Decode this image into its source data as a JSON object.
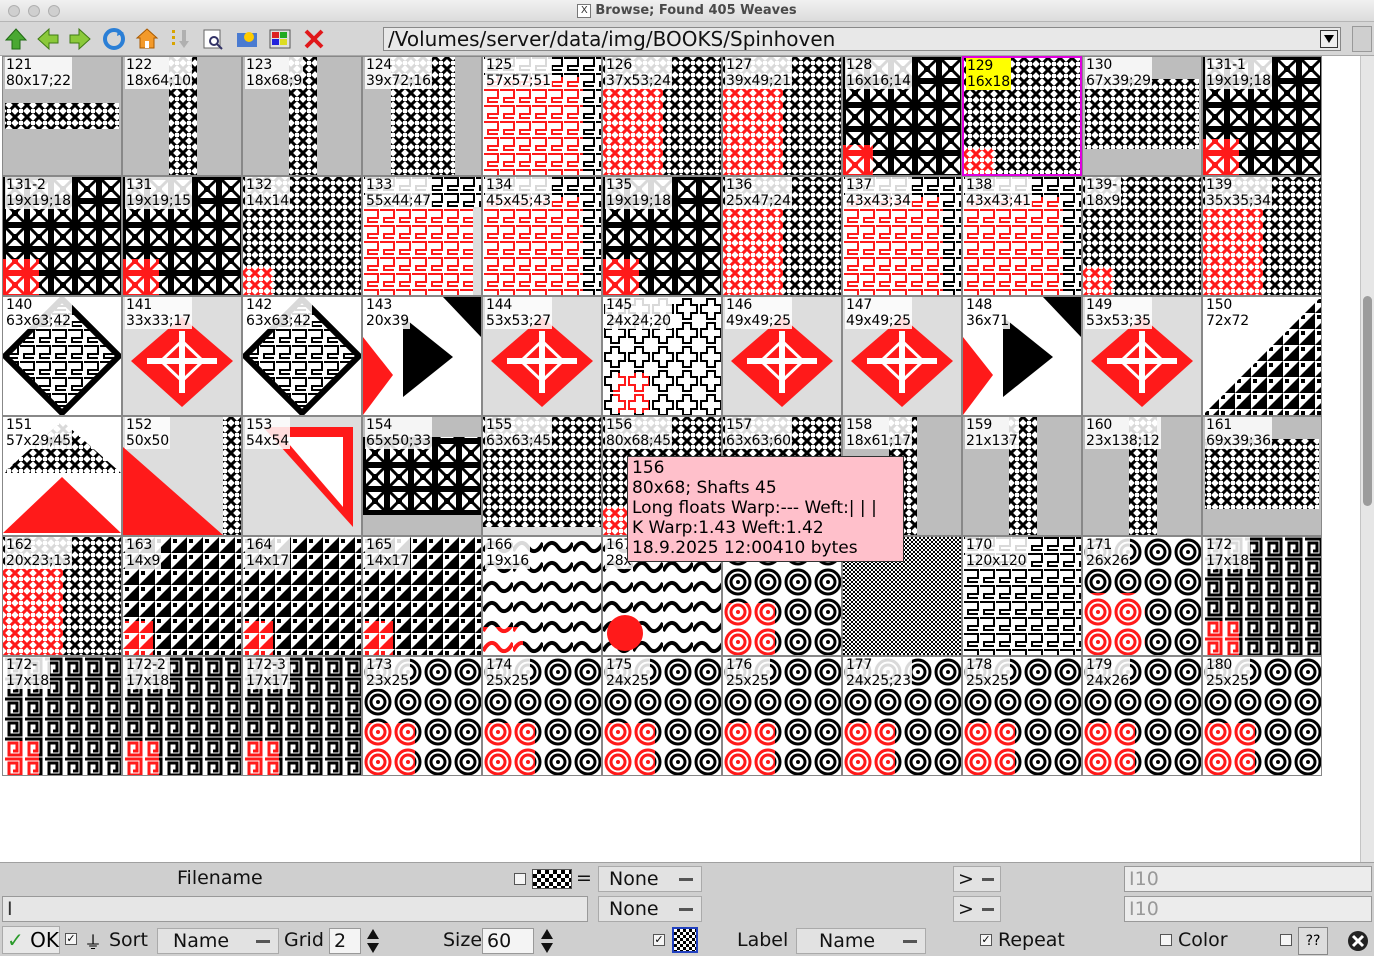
{
  "window": {
    "title": "Browse; Found 405 Weaves"
  },
  "toolbar": {
    "path": "/Volumes/server/data/img/BOOKS/Spinhoven",
    "icons": [
      "up-arrow-icon",
      "left-arrow-icon",
      "right-arrow-icon",
      "refresh-icon",
      "home-icon",
      "sort-down-icon",
      "preview-icon",
      "settings-sun-icon",
      "image-palette-icon",
      "close-x-icon"
    ]
  },
  "tiles": [
    {
      "label": "121\n80x17;22",
      "pattern": "band"
    },
    {
      "label": "122\n18x64;10",
      "pattern": "vstrip"
    },
    {
      "label": "123\n18x68;9",
      "pattern": "vstrip"
    },
    {
      "label": "124\n39x72;16",
      "pattern": "vstrip2"
    },
    {
      "label": "125\n57x57;51",
      "pattern": "redmaze"
    },
    {
      "label": "126\n37x53;24",
      "pattern": "redknot"
    },
    {
      "label": "127\n39x49;21",
      "pattern": "redknot"
    },
    {
      "label": "128\n16x16;14",
      "pattern": "diamonds"
    },
    {
      "label": "129\n16x18",
      "pattern": "knotgrid",
      "selected": true
    },
    {
      "label": "130\n67x39;29",
      "pattern": "band2"
    },
    {
      "label": "131-1\n19x19;18",
      "pattern": "squares"
    },
    {
      "label": "131-2\n19x19;18",
      "pattern": "squares"
    },
    {
      "label": "131\n19x19;15",
      "pattern": "squares"
    },
    {
      "label": "132\n14x14",
      "pattern": "knotgrid"
    },
    {
      "label": "133\n55x44;47",
      "pattern": "redlarge"
    },
    {
      "label": "134\n45x45;43",
      "pattern": "redmaze"
    },
    {
      "label": "135\n19x19;18",
      "pattern": "squares"
    },
    {
      "label": "136\n25x47;24",
      "pattern": "redknot"
    },
    {
      "label": "137\n43x43;34",
      "pattern": "redmaze"
    },
    {
      "label": "138\n43x43;41",
      "pattern": "redmaze"
    },
    {
      "label": "139-\n18x9",
      "pattern": "knotgrid"
    },
    {
      "label": "139\n35x35;34",
      "pattern": "redknot"
    },
    {
      "label": "140\n63x63;42",
      "pattern": "bigdiamond"
    },
    {
      "label": "141\n33x33;17",
      "pattern": "reddiamond"
    },
    {
      "label": "142\n63x63;42",
      "pattern": "bigdiamond"
    },
    {
      "label": "143\n20x39",
      "pattern": "triangles"
    },
    {
      "label": "144\n53x53;27",
      "pattern": "reddiamond"
    },
    {
      "label": "145\n24x24;20",
      "pattern": "crosses"
    },
    {
      "label": "146\n49x49;25",
      "pattern": "reddiamond"
    },
    {
      "label": "147\n49x49;25",
      "pattern": "reddiamond"
    },
    {
      "label": "148\n36x71",
      "pattern": "triangles"
    },
    {
      "label": "149\n53x53;35",
      "pattern": "reddiamond"
    },
    {
      "label": "150\n72x72",
      "pattern": "halftri"
    },
    {
      "label": "151\n57x29;45",
      "pattern": "redtriangle"
    },
    {
      "label": "152\n50x50",
      "pattern": "redhalftri"
    },
    {
      "label": "153\n54x54",
      "pattern": "redcorner"
    },
    {
      "label": "154\n65x50;33",
      "pattern": "squares2"
    },
    {
      "label": "155\n63x63;45",
      "pattern": "lattice"
    },
    {
      "label": "156\n80x68;45",
      "pattern": "knotgrid"
    },
    {
      "label": "157\n63x63;60",
      "pattern": "knotgrid"
    },
    {
      "label": "158\n18x61;17",
      "pattern": "vstrip"
    },
    {
      "label": "159\n21x137",
      "pattern": "vstrip"
    },
    {
      "label": "160\n23x138;12",
      "pattern": "vstrip"
    },
    {
      "label": "161\n69x39;36",
      "pattern": "band2"
    },
    {
      "label": "162\n20x23;13",
      "pattern": "redknot"
    },
    {
      "label": "163\n14x9",
      "pattern": "steps"
    },
    {
      "label": "164\n14x17",
      "pattern": "steps"
    },
    {
      "label": "165\n14x17",
      "pattern": "steps"
    },
    {
      "label": "166\n19x16",
      "pattern": "waves"
    },
    {
      "label": "167\n28x",
      "pattern": "redspiral"
    },
    {
      "label": "",
      "pattern": "spirals"
    },
    {
      "label": "",
      "pattern": "checker"
    },
    {
      "label": "170\n120x120",
      "pattern": "maze"
    },
    {
      "label": "171\n26x26",
      "pattern": "redspiral2"
    },
    {
      "label": "172\n17x18",
      "pattern": "greek"
    },
    {
      "label": "172-\n17x18",
      "pattern": "greek"
    },
    {
      "label": "172-2\n17x18",
      "pattern": "greek"
    },
    {
      "label": "172-3\n17x17",
      "pattern": "greek"
    },
    {
      "label": "173\n23x25",
      "pattern": "spirals"
    },
    {
      "label": "174\n25x25",
      "pattern": "spirals"
    },
    {
      "label": "175\n24x25",
      "pattern": "spirals"
    },
    {
      "label": "176\n25x25",
      "pattern": "spirals"
    },
    {
      "label": "177\n24x25;23",
      "pattern": "spirals"
    },
    {
      "label": "178\n25x25",
      "pattern": "spirals"
    },
    {
      "label": "179\n24x26",
      "pattern": "spirals"
    },
    {
      "label": "180\n25x25",
      "pattern": "spirals"
    }
  ],
  "tooltip": {
    "line1": "156",
    "line2": "80x68; Shafts 45",
    "line3": "Long floats Warp:--- Weft:| | |",
    "line4": "K Warp:1.43 Weft:1.42",
    "line5": "18.9.2025 12:00410 bytes"
  },
  "bottom": {
    "filename_label": "Filename",
    "eq": "=",
    "filter1_value": "None",
    "filter2_value": "None",
    "cmp1": ">",
    "cmp2": ">",
    "num1_placeholder": "10",
    "num2_placeholder": "10",
    "ok_label": "OK",
    "sort_label": "Sort",
    "sort_value": "Name",
    "grid_label": "Grid",
    "grid_value": "2",
    "size_label": "Size",
    "size_value": "60",
    "label_label": "Label",
    "label_value": "Name",
    "repeat_label": "Repeat",
    "color_label": "Color",
    "help_label": "??"
  },
  "colors": {
    "red": "#ff1a1a",
    "black": "#000000",
    "tooltip_bg": "#ffc0cb",
    "selection": "#e000e0",
    "highlight": "#ffff00"
  }
}
